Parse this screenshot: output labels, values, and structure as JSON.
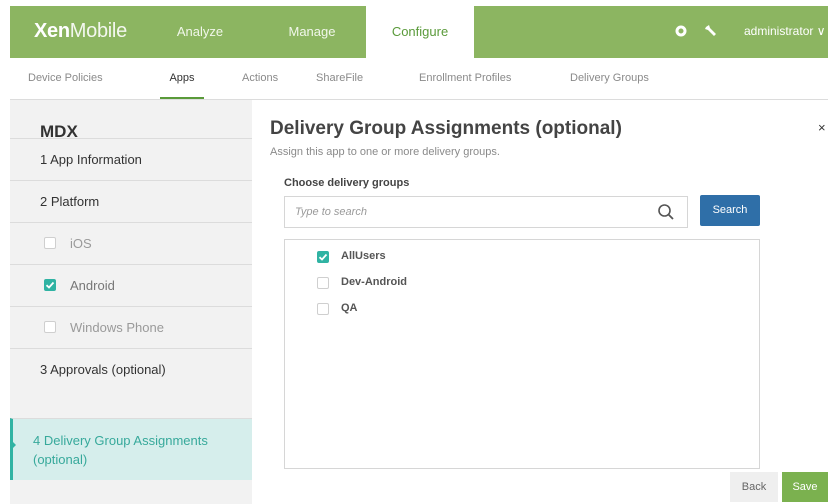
{
  "header": {
    "brand_bold": "Xen",
    "brand_light": "Mobile",
    "tabs": [
      {
        "label": "Analyze"
      },
      {
        "label": "Manage"
      },
      {
        "label": "Configure"
      }
    ],
    "user": "administrator ∨",
    "icons": {
      "settings": "gear-icon",
      "tools": "wrench-icon"
    }
  },
  "subnav": {
    "tabs": [
      {
        "label": "Device Policies"
      },
      {
        "label": "Apps"
      },
      {
        "label": "Actions"
      },
      {
        "label": "ShareFile"
      },
      {
        "label": "Enrollment Profiles"
      },
      {
        "label": "Delivery Groups"
      }
    ],
    "active": "Apps"
  },
  "sidebar": {
    "title": "MDX",
    "items": [
      {
        "label": "1  App Information"
      },
      {
        "label": "2  Platform"
      },
      {
        "label": "iOS",
        "checked": false
      },
      {
        "label": "Android",
        "checked": true
      },
      {
        "label": "Windows Phone",
        "checked": false
      },
      {
        "label": "3  Approvals (optional)"
      },
      {
        "label": "4  Delivery Group Assignments (optional)"
      }
    ]
  },
  "main": {
    "title": "Delivery Group Assignments (optional)",
    "subtitle": "Assign this app to one or more delivery groups.",
    "close": "×",
    "choose_label": "Choose delivery groups",
    "search_placeholder": "Type to search",
    "search_button": "Search",
    "groups": [
      {
        "label": "AllUsers",
        "checked": true
      },
      {
        "label": "Dev-Android",
        "checked": false
      },
      {
        "label": "QA",
        "checked": false
      }
    ],
    "back_button": "Back",
    "save_button": "Save"
  },
  "colors": {
    "header_green": "#8cb561",
    "accent_teal": "#30b3a3",
    "search_blue": "#2f6fa8",
    "save_green": "#7bb14f"
  }
}
